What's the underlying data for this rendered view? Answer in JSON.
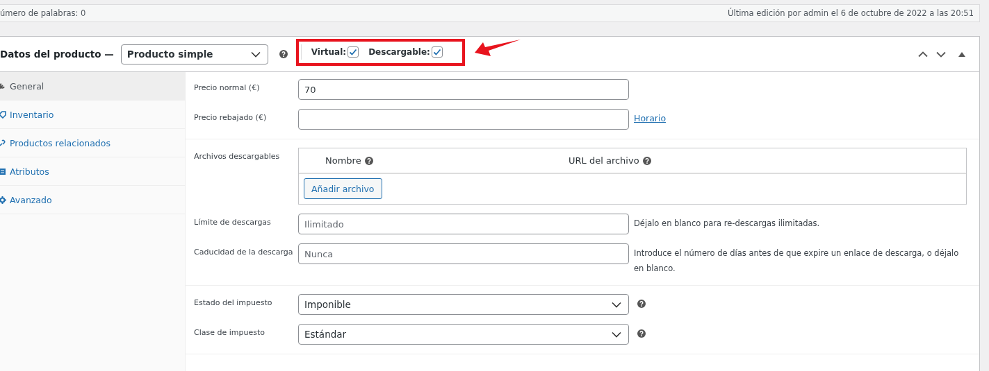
{
  "editor_status": {
    "word_count": "úmero de palabras: 0",
    "last_edit": "Última edición por admin el 6 de octubre de 2022 a las 20:51"
  },
  "product_data": {
    "title": "Datos del producto —",
    "product_type": "Producto simple",
    "options": [
      {
        "label": "Virtual:",
        "checked": true
      },
      {
        "label": "Descargable:",
        "checked": true
      }
    ]
  },
  "tabs": [
    {
      "label": "General",
      "selected": true
    },
    {
      "label": "Inventario",
      "selected": false
    },
    {
      "label": "Productos relacionados",
      "selected": false
    },
    {
      "label": "Atributos",
      "selected": false
    },
    {
      "label": "Avanzado",
      "selected": false
    }
  ],
  "sections": [
    {
      "fields": [
        {
          "kind": "text",
          "label": "Precio normal (€)",
          "value": "70"
        },
        {
          "kind": "text",
          "label": "Precio rebajado (€)",
          "link": "Horario"
        }
      ]
    },
    {
      "fields": [
        {
          "kind": "files",
          "label": "Archivos descargables",
          "columns": [
            "Nombre",
            "URL del archivo"
          ],
          "button": "Añadir archivo"
        },
        {
          "kind": "text",
          "label": "Límite de descargas",
          "placeholder": "Ilimitado",
          "description": "Déjalo en blanco para re-descargas ilimitadas."
        },
        {
          "kind": "text",
          "label": "Caducidad de la descarga",
          "placeholder": "Nunca",
          "description": "Introduce el número de días antes de que expire un enlace de descarga, o déjalo en blanco."
        }
      ]
    },
    {
      "fields": [
        {
          "kind": "select",
          "label": "Estado del impuesto",
          "value": "Imponible"
        },
        {
          "kind": "select",
          "label": "Clase de impuesto",
          "value": "Estándar"
        }
      ]
    }
  ]
}
